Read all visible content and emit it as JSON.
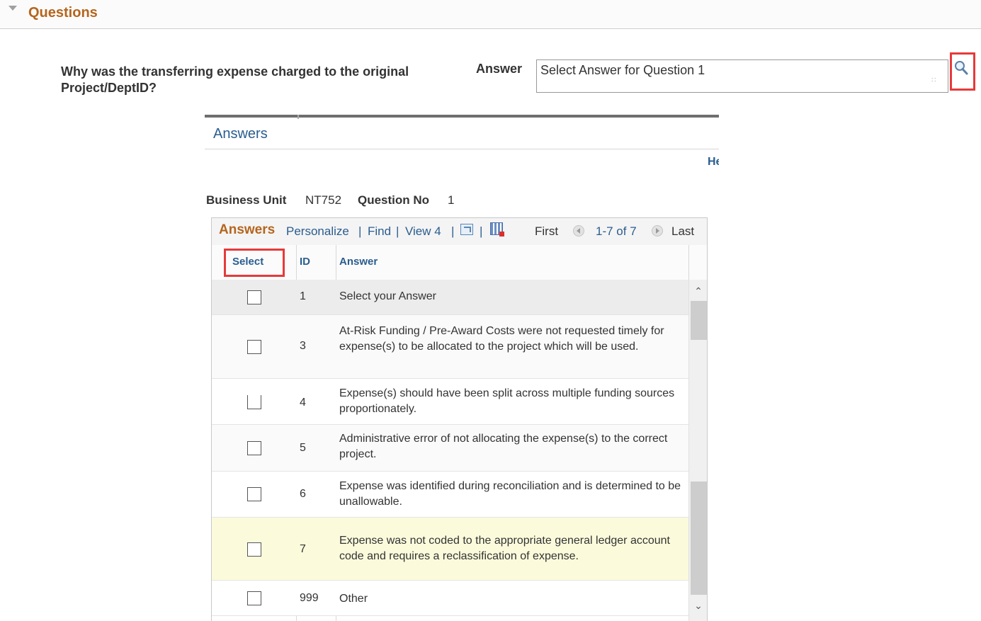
{
  "section": {
    "title": "Questions"
  },
  "question": {
    "text": "Why was the transferring expense charged to the original Project/DeptID?",
    "answer_label": "Answer",
    "answer_value": "Select Answer for Question 1"
  },
  "popup": {
    "title": "Answers",
    "help_link": "Help",
    "business_unit_label": "Business Unit",
    "business_unit_value": "NT752",
    "question_no_label": "Question No",
    "question_no_value": "1"
  },
  "grid": {
    "title": "Answers",
    "personalize": "Personalize",
    "find": "Find",
    "view": "View 4",
    "first": "First",
    "range": "1-7 of 7",
    "last": "Last",
    "columns": {
      "select": "Select",
      "id": "ID",
      "answer": "Answer"
    },
    "rows": [
      {
        "id": "1",
        "answer": "Select your Answer",
        "checked": false,
        "highlight": "hover"
      },
      {
        "id": "3",
        "answer": "At-Risk Funding / Pre-Award Costs were not requested timely for expense(s) to be allocated to the project which will be used.",
        "checked": false
      },
      {
        "id": "4",
        "answer": "Expense(s) should have been split across multiple funding sources proportionately.",
        "checked": false
      },
      {
        "id": "5",
        "answer": "Administrative error of not allocating the expense(s) to the correct project.",
        "checked": false
      },
      {
        "id": "6",
        "answer": "Expense was identified during reconciliation and is determined to be unallowable.",
        "checked": false
      },
      {
        "id": "7",
        "answer": "Expense was not coded to the appropriate general ledger account code and requires a reclassification of expense.",
        "checked": false,
        "highlight": "selected"
      },
      {
        "id": "999",
        "answer": "Other",
        "checked": false
      }
    ]
  },
  "colors": {
    "section_title": "#b5651d",
    "link": "#2a5d8f",
    "highlight_box": "#e63a3a",
    "selected_row": "#fbfbdc",
    "hover_row": "#ececec"
  },
  "icons": {
    "section_toggle": "triangle-down-icon",
    "lookup": "magnifier-icon",
    "zoom": "zoom-icon",
    "download": "download-to-excel-icon",
    "prev": "circle-left-arrow-icon",
    "next": "circle-right-arrow-icon"
  }
}
